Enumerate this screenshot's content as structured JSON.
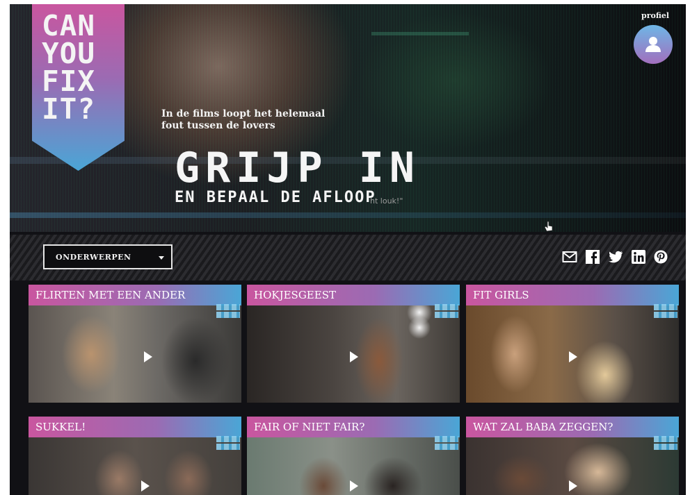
{
  "hero": {
    "logo_lines": [
      "CAN",
      "YOU",
      "FIX",
      "IT?"
    ],
    "tagline_line1": "In de films loopt het helemaal",
    "tagline_line2": "fout tussen de lovers",
    "headline": "GRIJP IN",
    "subheadline": "EN BEPAAL DE AFLOOP",
    "quote": "ht louk!\"",
    "profile_label": "profiel"
  },
  "toolbar": {
    "topics_label": "ONDERWERPEN",
    "share_icons": [
      "mail-icon",
      "facebook-icon",
      "twitter-icon",
      "linkedin-icon",
      "pinterest-icon"
    ]
  },
  "cards": [
    {
      "title": "FLIRTEN MET EEN ANDER"
    },
    {
      "title": "HOKJESGEEST"
    },
    {
      "title": "FIT GIRLS"
    },
    {
      "title": "SUKKEL!"
    },
    {
      "title": "FAIR OF NIET FAIR?"
    },
    {
      "title": "WAT ZAL BABA ZEGGEN?"
    }
  ],
  "colors": {
    "brand_pink": "#c9569f",
    "brand_purple": "#9b6bb3",
    "brand_blue": "#4aa6d6",
    "background": "#111115"
  }
}
